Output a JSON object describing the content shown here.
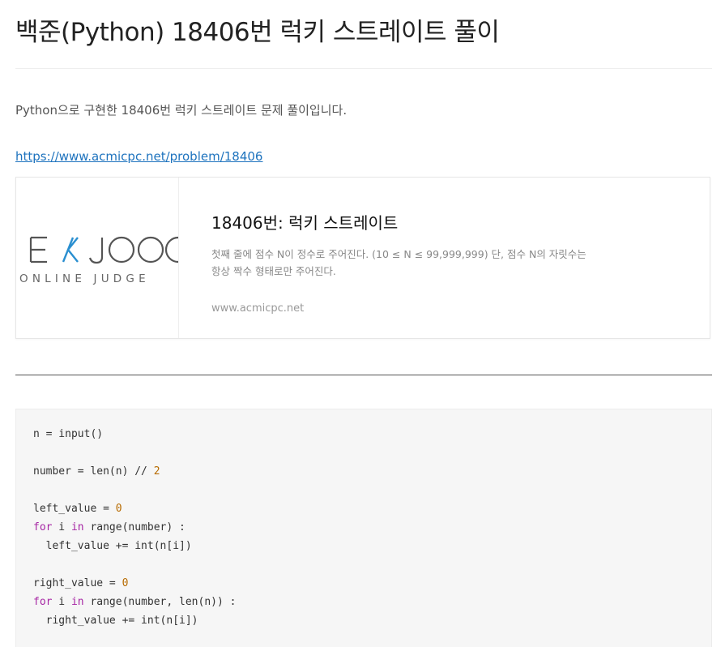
{
  "post": {
    "title": "백준(Python) 18406번 럭키 스트레이트 풀이",
    "intro": "Python으로 구현한 18406번 럭키 스트레이트 문제 풀이입니다.",
    "link": "https://www.acmicpc.net/problem/18406"
  },
  "og_card": {
    "logo_word": "BAEKJOON",
    "logo_sub": "ONLINE JUDGE",
    "title": "18406번: 럭키 스트레이트",
    "description": "첫째 줄에 점수 N이 정수로 주어진다. (10 ≤ N ≤ 99,999,999) 단, 점수 N의 자릿수는 항상 짝수 형태로만 주어진다.",
    "domain": "www.acmicpc.net"
  },
  "code": {
    "lines": [
      {
        "indent": "",
        "parts": [
          {
            "t": "n = input()",
            "c": "plain"
          }
        ]
      },
      {
        "indent": "",
        "parts": []
      },
      {
        "indent": "",
        "parts": [
          {
            "t": "number = len(n) // ",
            "c": "plain"
          },
          {
            "t": "2",
            "c": "num"
          }
        ]
      },
      {
        "indent": "",
        "parts": []
      },
      {
        "indent": "",
        "parts": [
          {
            "t": "left_value = ",
            "c": "plain"
          },
          {
            "t": "0",
            "c": "num"
          }
        ]
      },
      {
        "indent": "",
        "parts": [
          {
            "t": "for",
            "c": "kw"
          },
          {
            "t": " i ",
            "c": "plain"
          },
          {
            "t": "in",
            "c": "kw"
          },
          {
            "t": " range(number) :",
            "c": "plain"
          }
        ]
      },
      {
        "indent": "  ",
        "parts": [
          {
            "t": "left_value += int(n[i])",
            "c": "plain"
          }
        ]
      },
      {
        "indent": "",
        "parts": []
      },
      {
        "indent": "",
        "parts": [
          {
            "t": "right_value = ",
            "c": "plain"
          },
          {
            "t": "0",
            "c": "num"
          }
        ]
      },
      {
        "indent": "",
        "parts": [
          {
            "t": "for",
            "c": "kw"
          },
          {
            "t": " i ",
            "c": "plain"
          },
          {
            "t": "in",
            "c": "kw"
          },
          {
            "t": " range(number, len(n)) :",
            "c": "plain"
          }
        ]
      },
      {
        "indent": "  ",
        "parts": [
          {
            "t": "right_value += int(n[i])",
            "c": "plain"
          }
        ]
      }
    ]
  },
  "colors": {
    "link": "#1e73be",
    "keyword": "#a626a4",
    "number": "#b76b01",
    "logo_dark": "#555555",
    "logo_accent": "#2a8fd0"
  }
}
